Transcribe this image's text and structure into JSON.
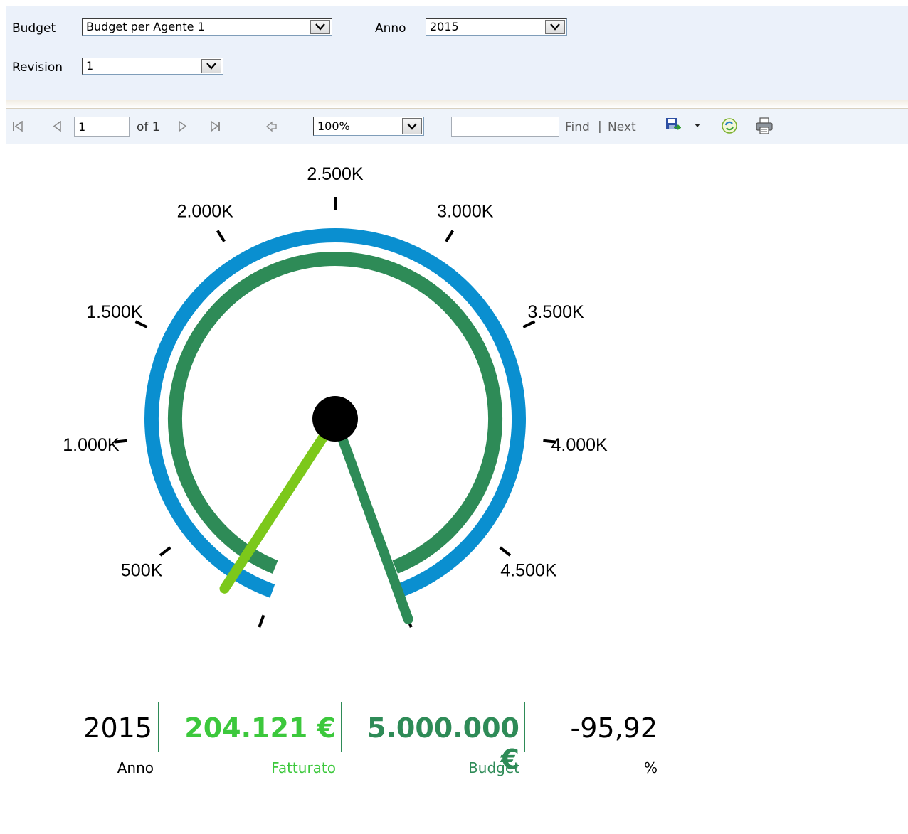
{
  "params": {
    "budget_label": "Budget",
    "budget_value": "Budget per Agente 1",
    "anno_label": "Anno",
    "anno_value": "2015",
    "revision_label": "Revision",
    "revision_value": "1"
  },
  "toolbar": {
    "page_value": "1",
    "page_of": "of 1",
    "zoom_value": "100%",
    "find_value": "",
    "find_label": "Find",
    "find_sep": "|",
    "next_label": "Next",
    "icons": [
      "first-page-icon",
      "prev-page-icon",
      "next-page-icon",
      "last-page-icon",
      "back-icon",
      "export-icon",
      "refresh-icon",
      "print-icon"
    ]
  },
  "gauge": {
    "tick_labels": [
      "500K",
      "1.000K",
      "1.500K",
      "2.000K",
      "2.500K",
      "3.000K",
      "3.500K",
      "4.000K",
      "4.500K"
    ],
    "min": 0,
    "max": 5000000,
    "actual_value": 204121,
    "budget_value": 5000000,
    "colors": {
      "outer_ring": "#0a8fd0",
      "inner_ring": "#2e8b57",
      "actual_pointer": "#7cc81a",
      "budget_pointer": "#2e8b57",
      "cap": "#000000"
    }
  },
  "summary": {
    "anno_value": "2015",
    "anno_label": "Anno",
    "fatturato_value": "204.121 €",
    "fatturato_label": "Fatturato",
    "budget_value": "5.000.000 €",
    "budget_label": "Budget",
    "percent_value": "-95,92",
    "percent_label": "%"
  }
}
